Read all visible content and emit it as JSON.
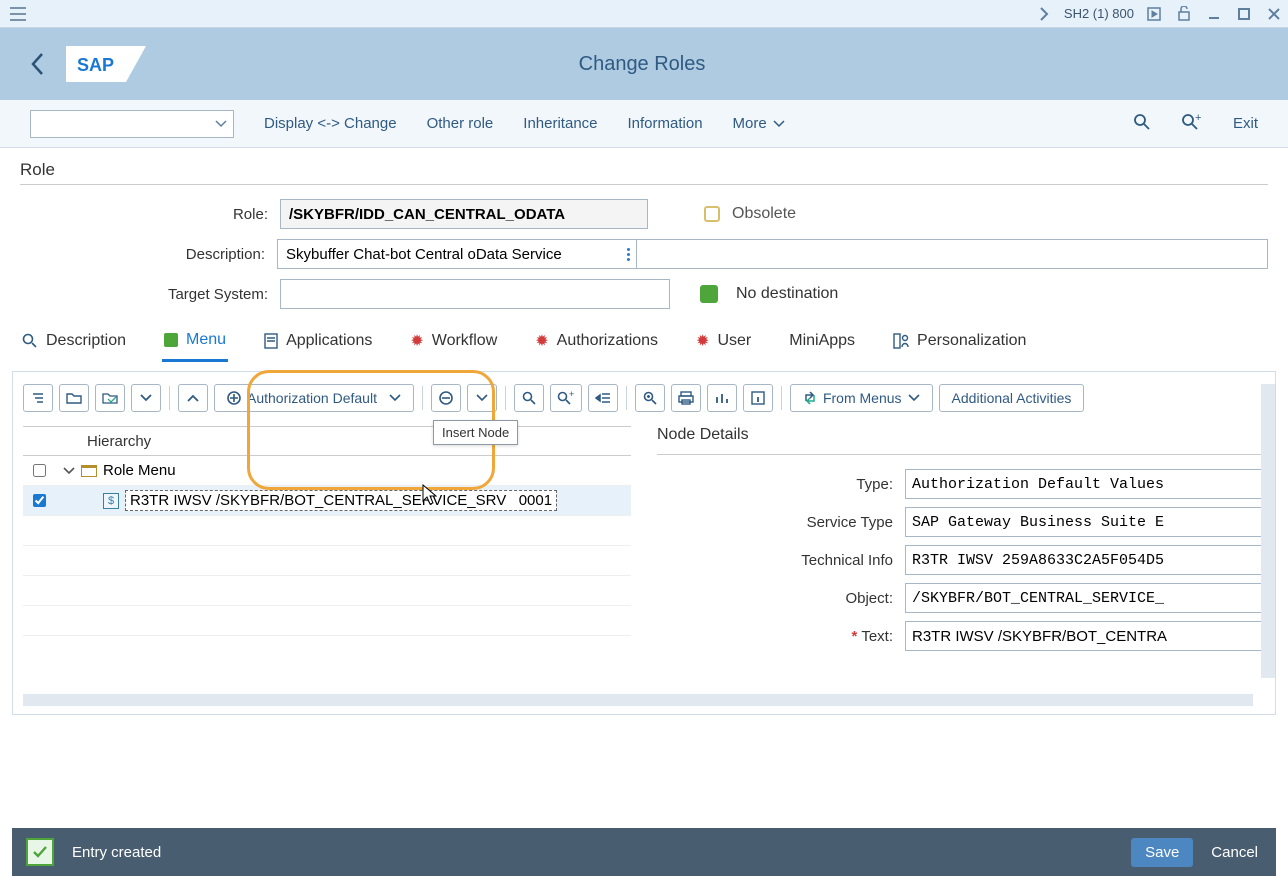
{
  "window": {
    "system_id": "SH2 (1) 800"
  },
  "title": "Change Roles",
  "actions": {
    "display_change": "Display <-> Change",
    "other_role": "Other role",
    "inheritance": "Inheritance",
    "information": "Information",
    "more": "More",
    "exit": "Exit"
  },
  "form": {
    "section_title": "Role",
    "role_label": "Role:",
    "role_value": "/SKYBFR/IDD_CAN_CENTRAL_ODATA",
    "obsolete_label": "Obsolete",
    "description_label": "Description:",
    "description_value": "Skybuffer Chat-bot Central oData Service",
    "target_label": "Target System:",
    "target_value": "",
    "no_destination": "No destination"
  },
  "tabs": [
    {
      "label": "Description",
      "kind": "search"
    },
    {
      "label": "Menu",
      "kind": "green",
      "active": true
    },
    {
      "label": "Applications",
      "kind": "doc"
    },
    {
      "label": "Workflow",
      "kind": "red"
    },
    {
      "label": "Authorizations",
      "kind": "red"
    },
    {
      "label": "User",
      "kind": "red"
    },
    {
      "label": "MiniApps",
      "kind": "none"
    },
    {
      "label": "Personalization",
      "kind": "pers"
    }
  ],
  "toolbar": {
    "auth_default": "Authorization Default",
    "tooltip": "Insert Node",
    "from_menus": "From Menus",
    "additional": "Additional Activities"
  },
  "tree": {
    "header": "Hierarchy",
    "root": "Role Menu",
    "node": "R3TR IWSV /SKYBFR/BOT_CENTRAL_SERVICE_SRV   0001"
  },
  "details": {
    "title": "Node Details",
    "rows": [
      {
        "label": "Type:",
        "value": "Authorization Default Values"
      },
      {
        "label": "Service Type",
        "value": "SAP Gateway Business Suite E"
      },
      {
        "label": "Technical Info",
        "value": "R3TR IWSV 259A8633C2A5F054D5"
      },
      {
        "label": "Object:",
        "value": "/SKYBFR/BOT_CENTRAL_SERVICE_"
      },
      {
        "label": "Text:",
        "value": "R3TR IWSV /SKYBFR/BOT_CENTRA",
        "required": true
      }
    ]
  },
  "footer": {
    "message": "Entry created",
    "save": "Save",
    "cancel": "Cancel"
  }
}
